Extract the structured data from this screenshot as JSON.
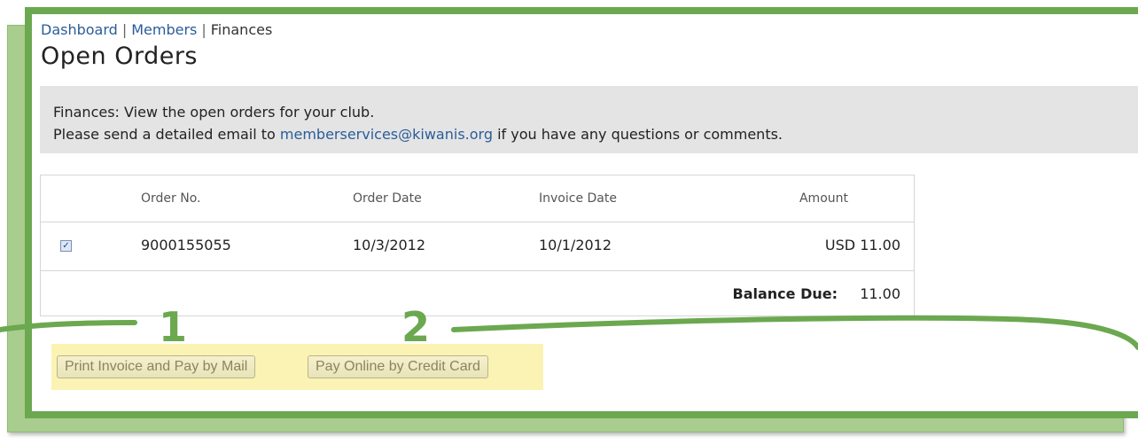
{
  "breadcrumb": {
    "dashboard": "Dashboard",
    "members": "Members",
    "finances": "Finances",
    "separator": "|"
  },
  "page_title": "Open Orders",
  "info": {
    "line1": "Finances: View the open orders for your club.",
    "line2_prefix": "Please send a detailed email to",
    "email": "memberservices@kiwanis.org",
    "line2_suffix": "if you have any questions or comments."
  },
  "orders": {
    "headers": {
      "order_no": "Order No.",
      "order_date": "Order Date",
      "invoice_date": "Invoice Date",
      "amount": "Amount"
    },
    "rows": [
      {
        "checked": true,
        "order_no": "9000155055",
        "order_date": "10/3/2012",
        "invoice_date": "10/1/2012",
        "amount": "USD 11.00"
      }
    ],
    "balance_label": "Balance Due:",
    "balance_value": "11.00"
  },
  "buttons": {
    "print_invoice": "Print Invoice and Pay by Mail",
    "pay_online": "Pay Online by Credit Card"
  },
  "callouts": [
    "1",
    "2"
  ],
  "colors": {
    "accent_green": "#6ba84f",
    "highlight_yellow": "#fbf3b4",
    "link_blue": "#2a5d9a",
    "info_gray": "#e4e4e4"
  }
}
